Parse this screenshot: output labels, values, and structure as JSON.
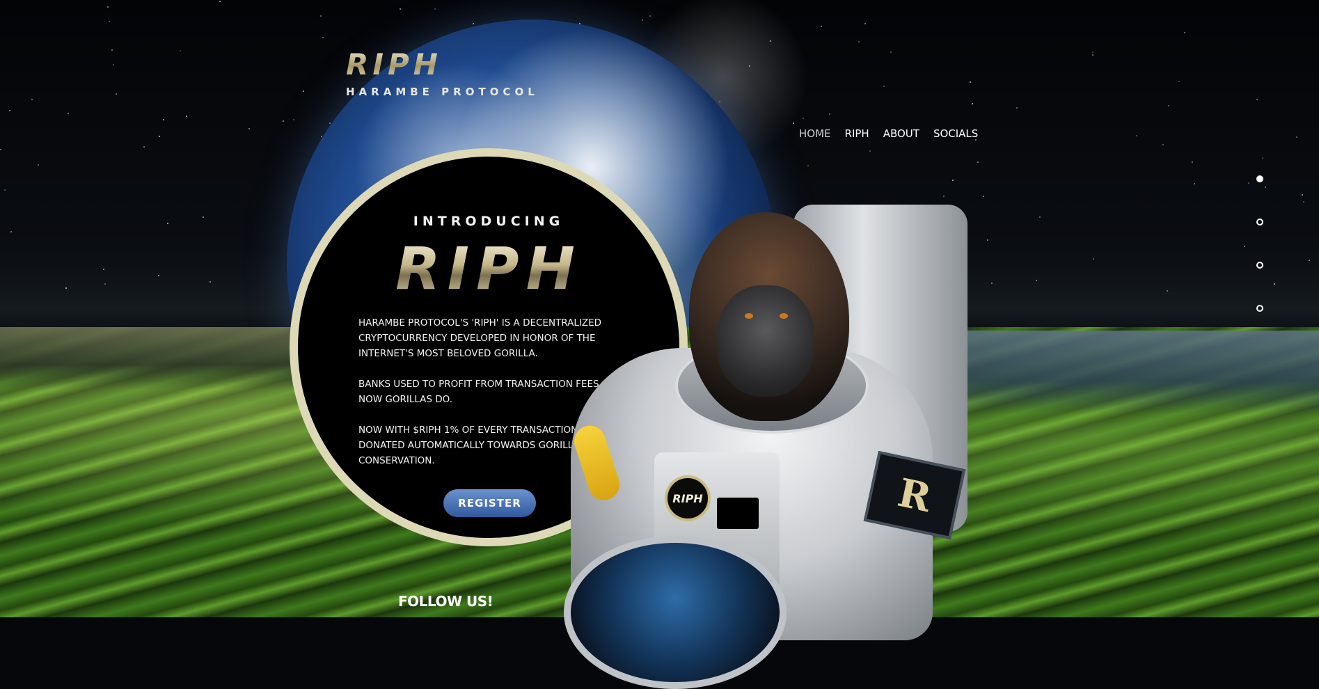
{
  "logo": {
    "title": "RIPH",
    "subtitle": "HARAMBE PROTOCOL"
  },
  "nav": {
    "items": [
      {
        "label": "HOME",
        "active": true
      },
      {
        "label": "RIPH",
        "active": false
      },
      {
        "label": "ABOUT",
        "active": false
      },
      {
        "label": "SOCIALS",
        "active": false
      }
    ]
  },
  "section_dots": {
    "count": 4,
    "active_index": 0
  },
  "hero": {
    "kicker": "INTRODUCING",
    "title": "RIPH",
    "paragraphs": [
      "HARAMBE PROTOCOL'S 'RIPH' IS A DECENTRALIZED CRYPTOCURRENCY DEVELOPED IN HONOR OF THE INTERNET'S MOST BELOVED GORILLA.",
      "BANKS USED TO PROFIT FROM TRANSACTION FEES. NOW GORILLAS DO.",
      "NOW WITH $RIPH 1% OF EVERY TRANSACTION IS DONATED AUTOMATICALLY TOWARDS GORILLA CONSERVATION."
    ],
    "register_label": "REGISTER"
  },
  "illustration": {
    "badge_text": "RIPH",
    "patch_text": "R"
  },
  "footer": {
    "follow_label": "FOLLOW US!"
  },
  "colors": {
    "circle_border": "#ddd9b6",
    "register_button": "#4a74b8",
    "gold_text": "#c4b68a"
  }
}
